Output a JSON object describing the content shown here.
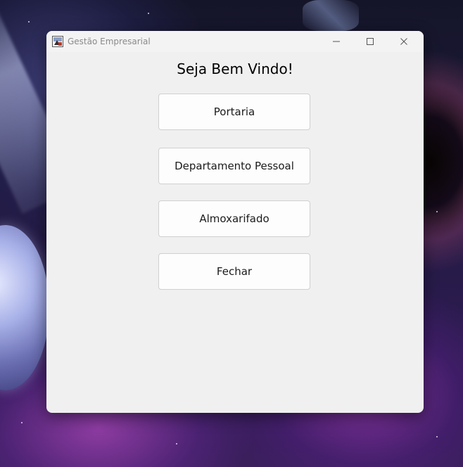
{
  "window": {
    "title": "Gestão Empresarial",
    "app_icon": "java-app-icon",
    "controls": {
      "minimize_icon": "minimize-icon",
      "maximize_icon": "maximize-icon",
      "close_icon": "close-icon"
    }
  },
  "main": {
    "heading": "Seja Bem Vindo!",
    "buttons": [
      {
        "label": "Portaria"
      },
      {
        "label": "Departamento Pessoal"
      },
      {
        "label": "Almoxarifado"
      },
      {
        "label": "Fechar"
      }
    ]
  },
  "colors": {
    "window_bg": "#f0f0f0",
    "button_bg": "#fdfdfd",
    "button_border": "#d0d0d0",
    "title_text": "#8a8a8a"
  }
}
